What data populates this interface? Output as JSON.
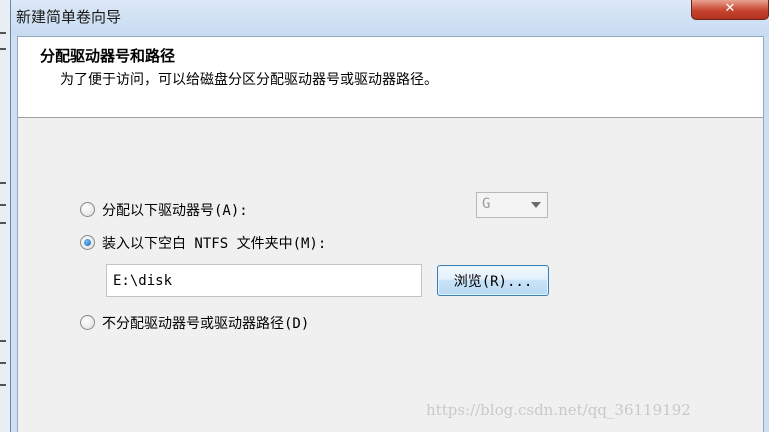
{
  "window": {
    "title": "新建简单卷向导",
    "close_symbol": "✕"
  },
  "header": {
    "title": "分配驱动器号和路径",
    "subtitle": "为了便于访问，可以给磁盘分区分配驱动器号或驱动器路径。"
  },
  "options": {
    "assign_letter": {
      "label": "分配以下驱动器号(A):",
      "checked": false
    },
    "mount_folder": {
      "label": "装入以下空白 NTFS 文件夹中(M):",
      "checked": true
    },
    "no_assign": {
      "label": "不分配驱动器号或驱动器路径(D)",
      "checked": false
    }
  },
  "drive_letter": {
    "value": "G",
    "enabled": false
  },
  "folder_path": {
    "value": "E:\\disk"
  },
  "browse_button": {
    "label": "浏览(R)..."
  },
  "watermark": {
    "text": "https://blog.csdn.net/qq_36119192"
  }
}
